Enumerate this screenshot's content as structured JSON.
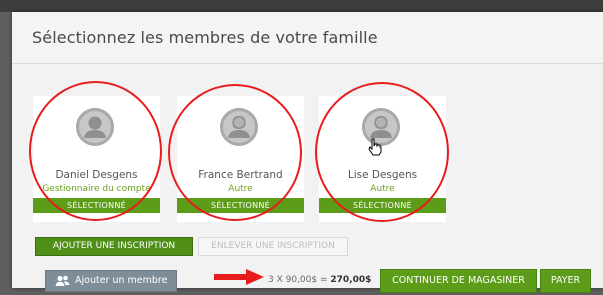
{
  "dialog": {
    "title": "Sélectionnez les membres de votre famille"
  },
  "members": [
    {
      "name": "Daniel Desgens",
      "role": "Gestionnaire du compte",
      "status": "SÉLECTIONNÉ",
      "avatar_icon": "person-icon"
    },
    {
      "name": "France Bertrand",
      "role": "Autre",
      "status": "SÉLECTIONNÉ",
      "avatar_icon": "person-female-icon"
    },
    {
      "name": "Lise Desgens",
      "role": "Autre",
      "status": "SÉLECTIONNÉ",
      "avatar_icon": "person-female-icon"
    }
  ],
  "actions": {
    "add_registration": "AJOUTER UNE INSCRIPTION",
    "remove_registration": "ENLEVER UNE INSCRIPTION",
    "add_member": "Ajouter un membre",
    "continue_shopping": "CONTINUER DE MAGASINER",
    "pay": "PAYER"
  },
  "summary": {
    "formula": "3 X 90,00$ = ",
    "total": "270,00$"
  },
  "colors": {
    "accent_green": "#5d9c18",
    "annotation_red": "#e81c1c",
    "secondary_button": "#7f8d99"
  },
  "annotations": {
    "arrow_icon": "red-arrow-icon",
    "circle_highlight": "red-circle"
  }
}
